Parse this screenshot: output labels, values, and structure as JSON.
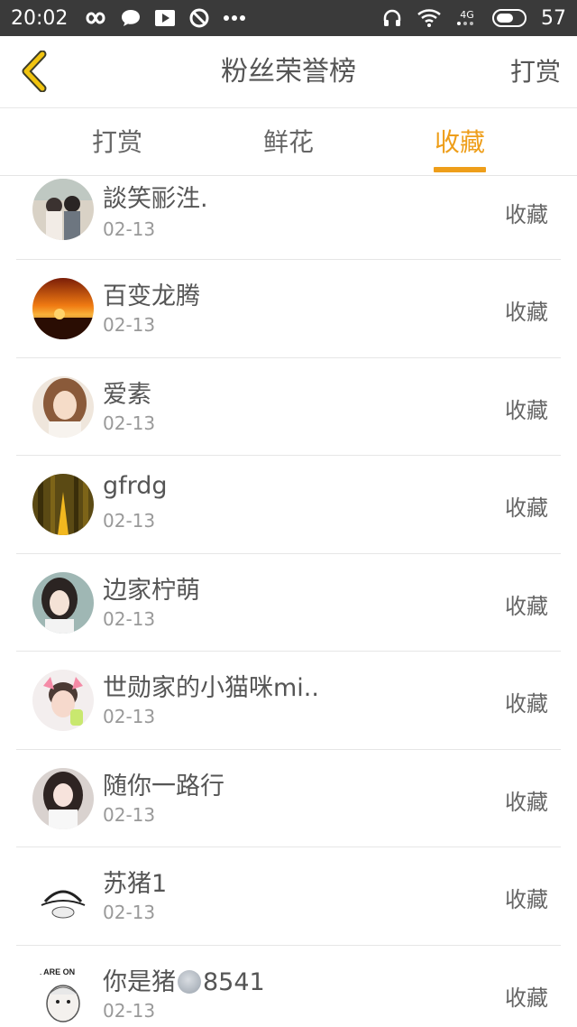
{
  "status_bar": {
    "time": "20:02",
    "battery": "57",
    "network_label": "4G"
  },
  "header": {
    "title": "粉丝荣誉榜",
    "right_action": "打赏"
  },
  "tabs": [
    {
      "label": "打赏",
      "active": false
    },
    {
      "label": "鲜花",
      "active": false
    },
    {
      "label": "收藏",
      "active": true
    }
  ],
  "colors": {
    "accent": "#ee9e1a",
    "status_bar": "#3a3a3a"
  },
  "fans": [
    {
      "name": "談笑彨泩.",
      "date": "02-13",
      "action": "收藏",
      "avatar": "couple-photo"
    },
    {
      "name": "百变龙腾",
      "date": "02-13",
      "action": "收藏",
      "avatar": "sunset-photo"
    },
    {
      "name": "爱素",
      "date": "02-13",
      "action": "收藏",
      "avatar": "girl-portrait"
    },
    {
      "name": "gfrdg",
      "date": "02-13",
      "action": "收藏",
      "avatar": "forest-path"
    },
    {
      "name": "边家柠萌",
      "date": "02-13",
      "action": "收藏",
      "avatar": "girl-braids"
    },
    {
      "name": "世勋家的小猫咪mi..",
      "date": "02-13",
      "action": "收藏",
      "avatar": "boy-cat-ears"
    },
    {
      "name": "随你一路行",
      "date": "02-13",
      "action": "收藏",
      "avatar": "girl-white-dress"
    },
    {
      "name": "苏猪1",
      "date": "02-13",
      "action": "收藏",
      "avatar": "sketch-hat"
    },
    {
      "name_prefix": "你是猪",
      "name_suffix": "8541",
      "name_emoji": "face-emoji",
      "date": "02-13",
      "action": "收藏",
      "avatar": "cartoon-are-on",
      "avatar_text": "E ARE ON"
    }
  ]
}
